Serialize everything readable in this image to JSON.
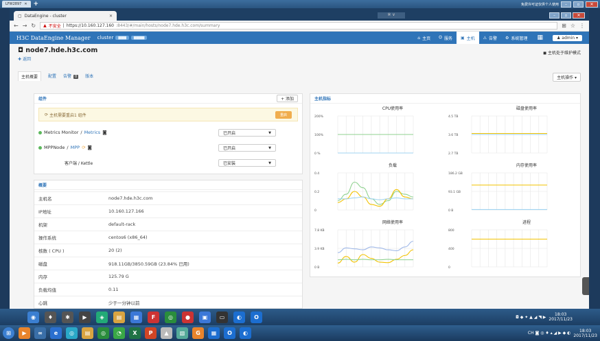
{
  "remote": {
    "tab_label": "LFW2897",
    "hint": "免费许可证仅供个人使用"
  },
  "browser": {
    "tab_title": "DataEngine - cluster",
    "blur_label": "※ ∨",
    "security_label": "不安全",
    "url_host": "https://10.160.127.160",
    "url_rest": ":8443/#/main/hosts/node7.hde.h3c.com/summary"
  },
  "app": {
    "brand": "H3C DataEngine Manager",
    "cluster_label": "cluster",
    "nav": [
      {
        "label": "主页",
        "icon": "home-icon",
        "glyph": "⌂"
      },
      {
        "label": "服务",
        "icon": "services-icon",
        "glyph": "⛭"
      },
      {
        "label": "主机",
        "icon": "hosts-icon",
        "glyph": "▣"
      },
      {
        "label": "告警",
        "icon": "alert-icon",
        "glyph": "⚠"
      },
      {
        "label": "系统管理",
        "icon": "admin-icon",
        "glyph": "⚙"
      }
    ],
    "user": "admin"
  },
  "host": {
    "name": "node7.hde.h3c.com",
    "back": "返回",
    "maintenance": "主机处于维护模式",
    "ops_button": "主机操作",
    "tabs": [
      "主机概要",
      "配置",
      "告警",
      "版本"
    ],
    "alert_count": "0"
  },
  "components": {
    "title": "组件",
    "add": "+ 添加",
    "notice": "主机需要重启1 组件",
    "restart": "重启",
    "items": [
      {
        "name": "Metrics Monitor",
        "service": "Metrics",
        "state": "已开启"
      },
      {
        "name": "MPPNode",
        "service": "MPP",
        "state": "已开启"
      },
      {
        "name": "客户端 / Kettle",
        "service": "",
        "state": "已安装"
      }
    ]
  },
  "summary": {
    "title": "概要",
    "rows": [
      {
        "k": "主机名",
        "v": "node7.hde.h3c.com"
      },
      {
        "k": "IP地址",
        "v": "10.160.127.166"
      },
      {
        "k": "机架",
        "v": "default-rack"
      },
      {
        "k": "操作系统",
        "v": "centos6 (x86_64)"
      },
      {
        "k": "核数 ( CPU )",
        "v": "20 (2)"
      },
      {
        "k": "磁盘",
        "v": "918.11GB/3850.59GB (23.84% 已用)"
      },
      {
        "k": "内存",
        "v": "125.79 G"
      },
      {
        "k": "负载均值",
        "v": "0.11"
      },
      {
        "k": "心跳",
        "v": "少于一分钟以前"
      }
    ]
  },
  "metrics": {
    "title": "主机指标",
    "chart_data": [
      {
        "type": "line",
        "title": "CPU使用率",
        "yticks": [
          "200%",
          "100%",
          "0 %"
        ],
        "ylim": [
          0,
          200
        ],
        "series": [
          {
            "color": "#8fd18f",
            "values": [
              100,
              100,
              100,
              100,
              100,
              100,
              100,
              100,
              100,
              100
            ]
          },
          {
            "color": "#9fd3f0",
            "values": [
              0,
              0,
              0,
              0,
              0,
              0,
              0,
              0,
              0,
              0
            ]
          }
        ]
      },
      {
        "type": "line",
        "title": "磁盘使用率",
        "yticks": [
          "4.5 TB",
          "3.6 TB",
          "2.7 TB"
        ],
        "ylim": [
          2.7,
          4.5
        ],
        "series": [
          {
            "color": "#f2c200",
            "values": [
              3.65,
              3.65,
              3.65,
              3.65,
              3.65,
              3.65,
              3.65,
              3.65,
              3.65,
              3.65
            ]
          },
          {
            "color": "#9fd3f0",
            "values": [
              3.6,
              3.6,
              3.6,
              3.6,
              3.6,
              3.6,
              3.6,
              3.6,
              3.6,
              3.6
            ]
          }
        ]
      },
      {
        "type": "line",
        "title": "负载",
        "yticks": [
          "0.4",
          "0.2",
          "0"
        ],
        "ylim": [
          0,
          0.4
        ],
        "series": [
          {
            "color": "#8fd18f",
            "values": [
              0.1,
              0.17,
              0.3,
              0.24,
              0.12,
              0.06,
              0.1,
              0.2,
              0.17,
              0.14
            ]
          },
          {
            "color": "#f2c200",
            "values": [
              0.08,
              0.12,
              0.2,
              0.14,
              0.06,
              0.04,
              0.12,
              0.22,
              0.14,
              0.12
            ]
          },
          {
            "color": "#9fd3f0",
            "values": [
              0.12,
              0.12,
              0.13,
              0.14,
              0.12,
              0.11,
              0.12,
              0.13,
              0.12,
              0.12
            ]
          }
        ]
      },
      {
        "type": "line",
        "title": "内存使用率",
        "yticks": [
          "186.2 GB",
          "93.1 GB",
          "0 B"
        ],
        "ylim": [
          0,
          186.2
        ],
        "series": [
          {
            "color": "#f2c200",
            "values": [
              125,
              125,
              125,
              125,
              125,
              125,
              125,
              125,
              125,
              125
            ]
          },
          {
            "color": "#9fd3f0",
            "values": [
              2,
              2,
              2,
              2,
              2,
              2,
              2,
              2,
              2,
              2
            ]
          }
        ]
      },
      {
        "type": "line",
        "title": "网络使用率",
        "yticks": [
          "7.8 KB",
          "3.9 KB",
          "0 B"
        ],
        "ylim": [
          0,
          7.8
        ],
        "series": [
          {
            "color": "#f2c200",
            "values": [
              0.8,
              2.2,
              1.0,
              2.6,
              1.8,
              1.0,
              0.9,
              1.6,
              2.4,
              3.6
            ]
          },
          {
            "color": "#9fb8e8",
            "values": [
              3.0,
              4.0,
              3.8,
              3.6,
              4.2,
              4.0,
              3.6,
              3.4,
              4.2,
              5.4
            ]
          },
          {
            "color": "#8fd18f",
            "values": [
              1.5,
              1.6,
              1.5,
              1.6,
              1.5,
              1.5,
              1.6,
              1.5,
              1.5,
              1.5
            ]
          }
        ]
      },
      {
        "type": "line",
        "title": "进程",
        "yticks": [
          "800",
          "400",
          "0"
        ],
        "ylim": [
          0,
          800
        ],
        "series": [
          {
            "color": "#f2c200",
            "values": [
              600,
              600,
              600,
              600,
              600,
              600,
              600,
              600,
              600,
              600
            ]
          }
        ]
      }
    ]
  },
  "taskbar": {
    "time": "18:03",
    "date": "2017/11/23"
  }
}
